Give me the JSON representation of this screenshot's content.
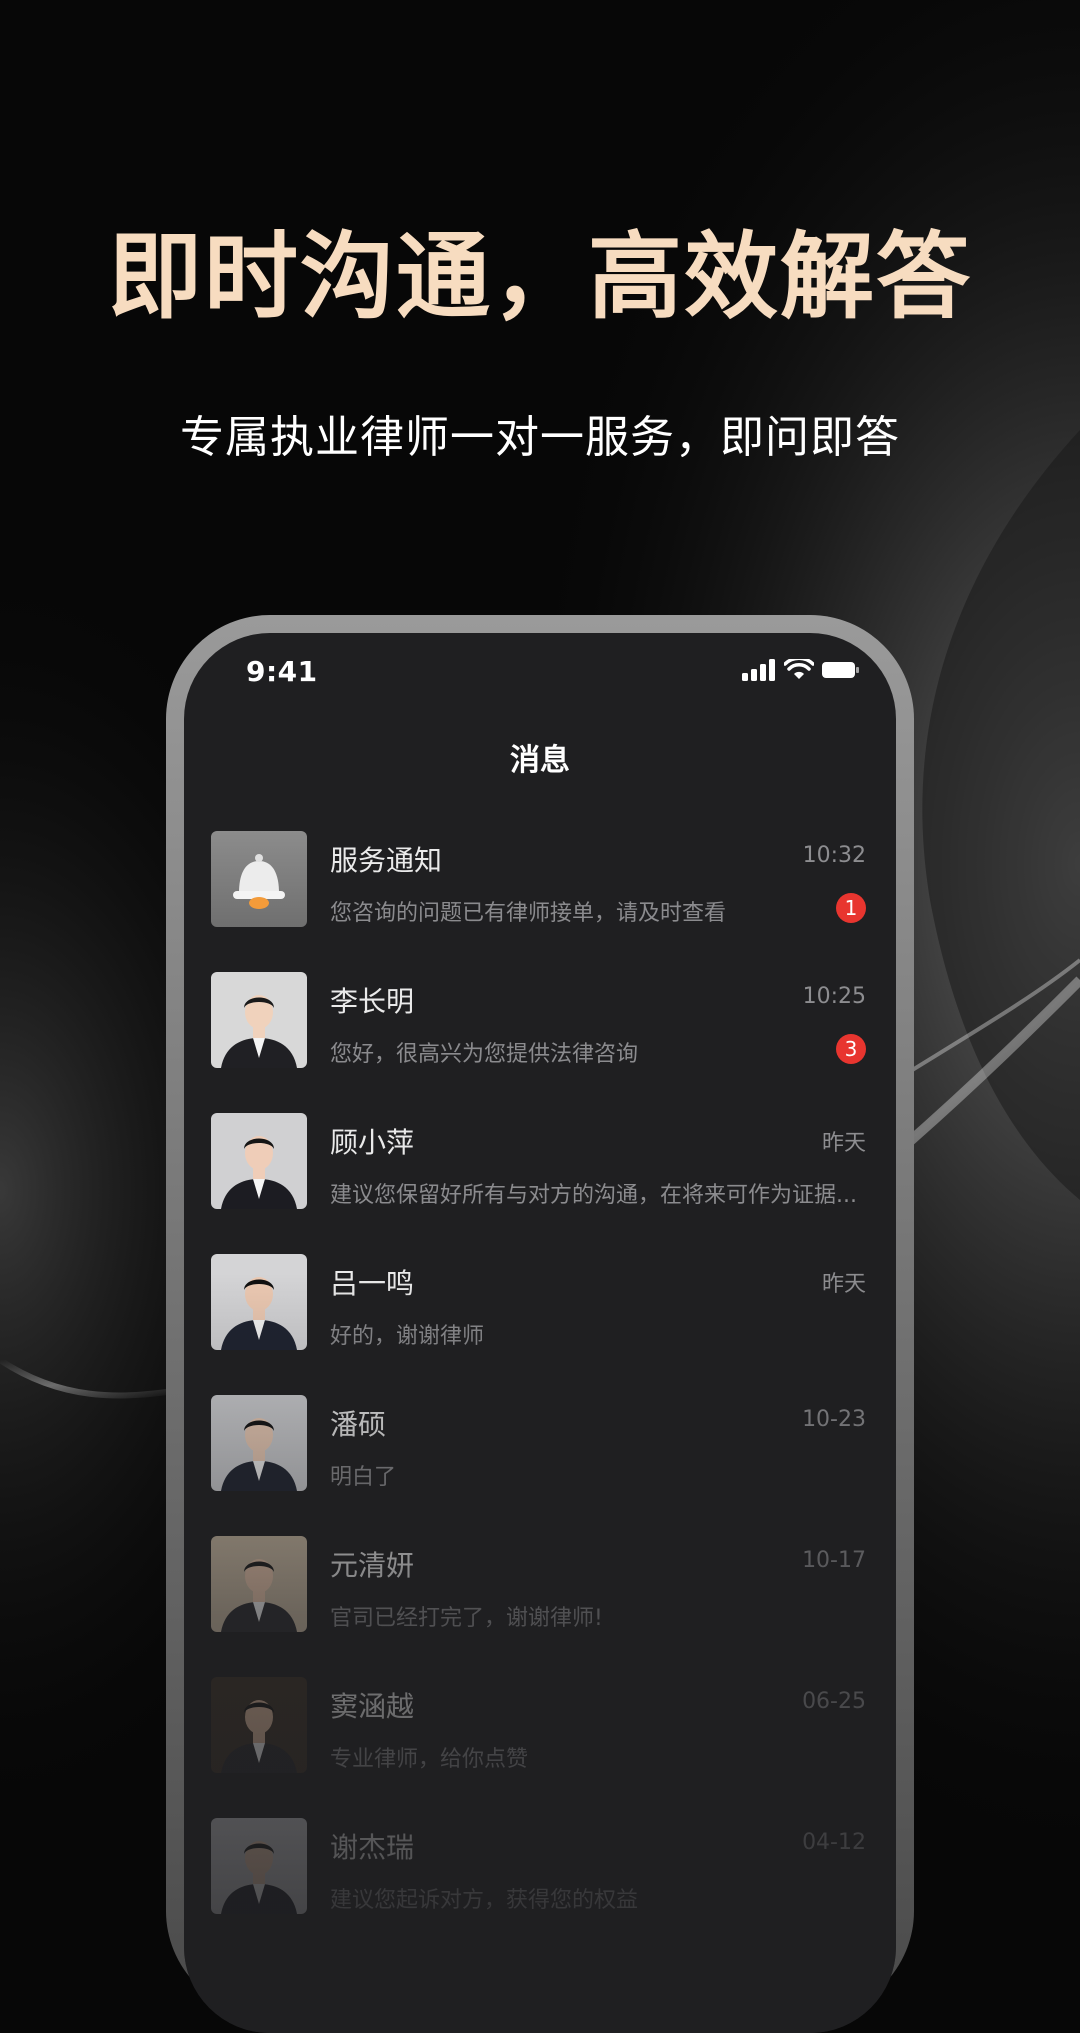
{
  "promo": {
    "headline": "即时沟通，高效解答",
    "subline": "专属执业律师一对一服务，即问即答"
  },
  "status_bar": {
    "time": "9:41",
    "icons": [
      "cellular-signal-icon",
      "wifi-icon",
      "battery-icon"
    ]
  },
  "nav": {
    "title": "消息"
  },
  "messages": [
    {
      "name": "服务通知",
      "preview": "您咨询的问题已有律师接单，请及时查看",
      "time": "10:32",
      "badge": "1",
      "avatar": "bell-icon"
    },
    {
      "name": "李长明",
      "preview": "您好，很高兴为您提供法律咨询",
      "time": "10:25",
      "badge": "3",
      "avatar": "lawyer-portrait"
    },
    {
      "name": "顾小萍",
      "preview": "建议您保留好所有与对方的沟通，在将来可作为证据...",
      "time": "昨天",
      "avatar": "lawyer-portrait"
    },
    {
      "name": "吕一鸣",
      "preview": "好的，谢谢律师",
      "time": "昨天",
      "avatar": "lawyer-portrait"
    },
    {
      "name": "潘硕",
      "preview": "明白了",
      "time": "10-23",
      "avatar": "lawyer-portrait"
    },
    {
      "name": "元清妍",
      "preview": "官司已经打完了，谢谢律师!",
      "time": "10-17",
      "avatar": "lawyer-portrait"
    },
    {
      "name": "窦涵越",
      "preview": "专业律师，给你点赞",
      "time": "06-25",
      "avatar": "lawyer-portrait"
    },
    {
      "name": "谢杰瑞",
      "preview": "建议您起诉对方，获得您的权益",
      "time": "04-12",
      "avatar": "lawyer-portrait"
    }
  ],
  "colors": {
    "headline": "#f7dcc0",
    "background": "#070707",
    "screen": "#1f1f21",
    "badge": "#e8352f"
  }
}
